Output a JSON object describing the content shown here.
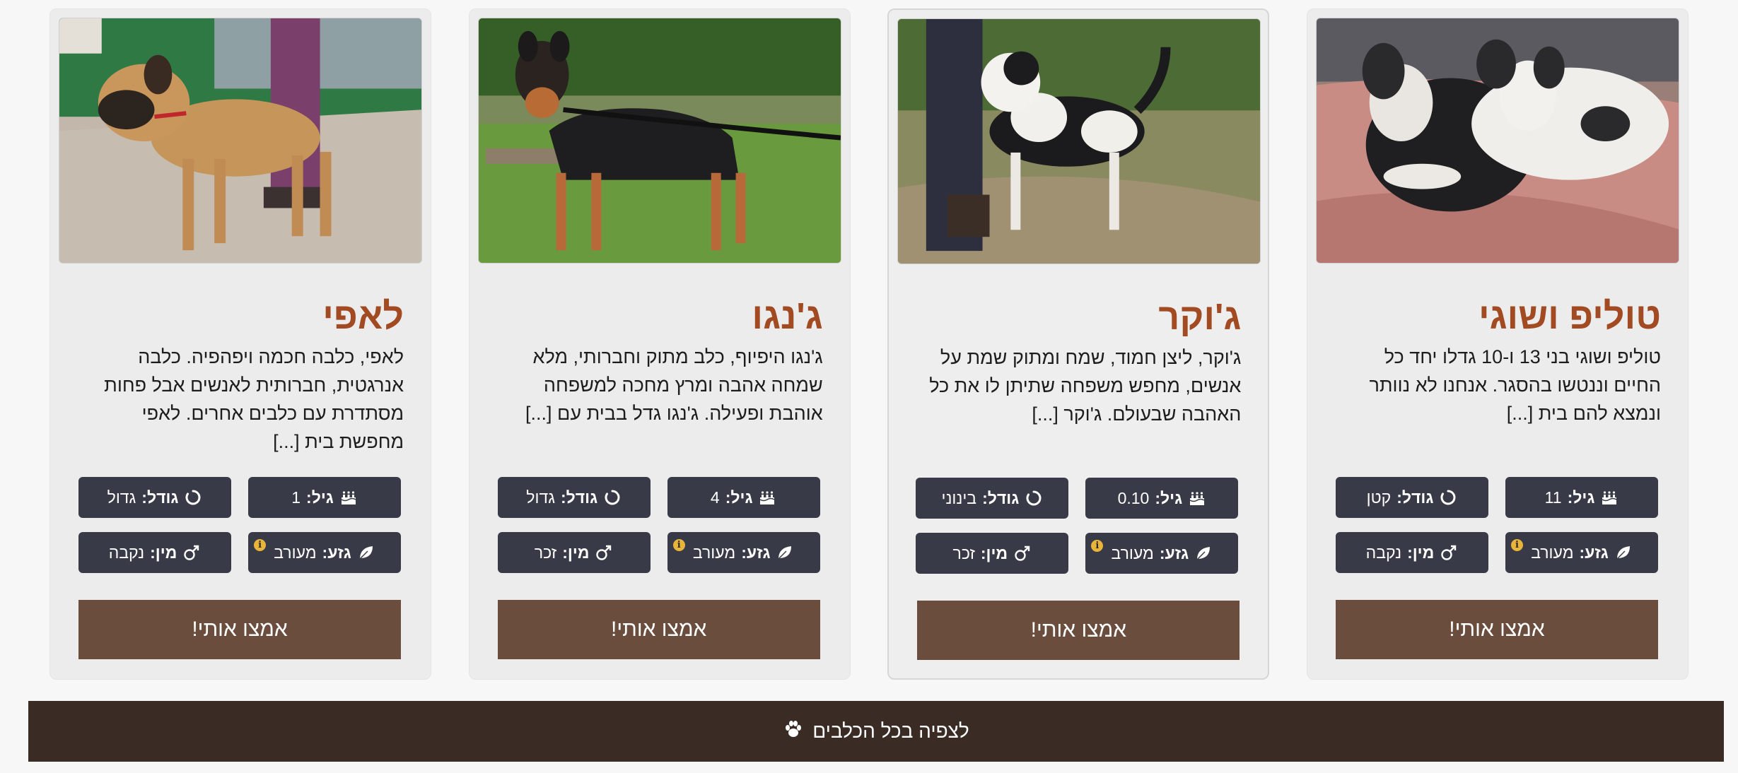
{
  "labels": {
    "age": "גיל:",
    "size": "גודל:",
    "breed": "גזע:",
    "sex": "מין:"
  },
  "icons": {
    "age": "cake-icon",
    "size": "circle-notch-icon",
    "breed": "leaf-icon",
    "sex": "male-symbol-icon",
    "info": "info-icon",
    "paw": "paw-icon"
  },
  "colors": {
    "title": "#a24b23",
    "pill": "#383b47",
    "adopt_button": "#6a4d3d",
    "footer_button": "#3a2c24",
    "info_badge": "#e8b53a"
  },
  "dogs": [
    {
      "name": "טוליפ ושוגי",
      "description": "טוליפ ושוגי בני 13 ו-10 גדלו יחד כל החיים וננטשו בהסגר. אנחנו לא נוותר ונמצא להם בית [...]",
      "age": "11",
      "size": "קטן",
      "breed": "מעורב",
      "sex": "נקבה",
      "adopt_label": "אמצו אותי!"
    },
    {
      "name": "ג'וקר",
      "description": "ג'וקר, ליצן חמוד, שמח ומתוק שמת על אנשים, מחפש משפחה שתיתן לו את כל האהבה שבעולם. ג'וקר [...]",
      "age": "0.10",
      "size": "בינוני",
      "breed": "מעורב",
      "sex": "זכר",
      "adopt_label": "אמצו אותי!"
    },
    {
      "name": "ג'נגו",
      "description": "ג'נגו היפיוף, כלב מתוק וחברותי, מלא שמחה אהבה ומרץ מחכה למשפחה אוהבת ופעילה. ג'נגו גדל בבית עם [...]",
      "age": "4",
      "size": "גדול",
      "breed": "מעורב",
      "sex": "זכר",
      "adopt_label": "אמצו אותי!"
    },
    {
      "name": "לאפי",
      "description": "לאפי, כלבה חכמה ויפהפיה. כלבה אנרגטית, חברותית לאנשים אבל פחות מסתדרת עם כלבים אחרים. לאפי מחפשת בית [...]",
      "age": "1",
      "size": "גדול",
      "breed": "מעורב",
      "sex": "נקבה",
      "adopt_label": "אמצו אותי!"
    }
  ],
  "footer": {
    "view_all_label": "לצפיה בכל הכלבים"
  }
}
